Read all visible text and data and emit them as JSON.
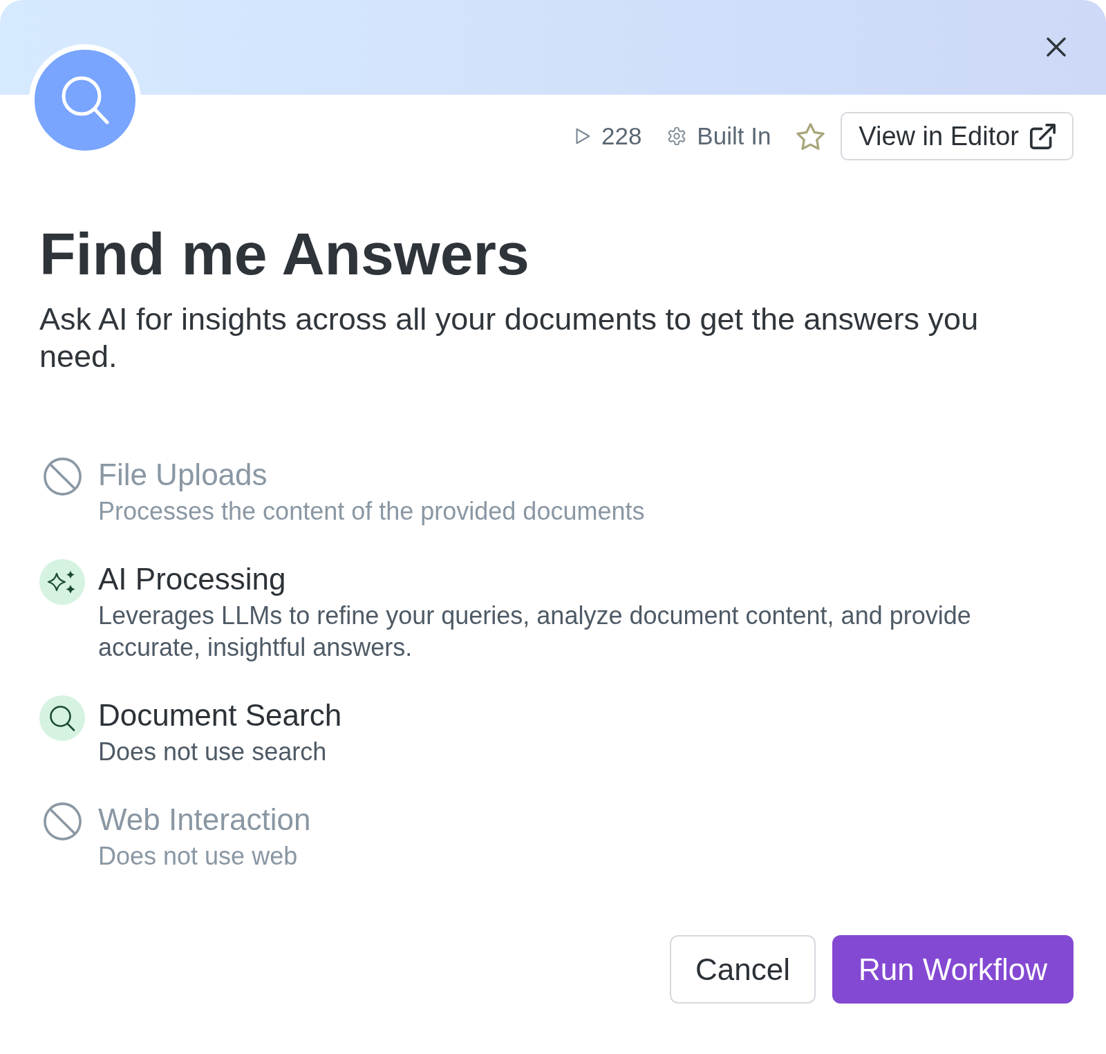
{
  "meta": {
    "run_count": "228",
    "source": "Built In",
    "starred": false,
    "editor_button": "View in Editor"
  },
  "title": "Find me Answers",
  "description": "Ask AI for insights across all your documents to get the answers you need.",
  "capabilities": [
    {
      "title": "File Uploads",
      "description": "Processes the content of the provided documents",
      "enabled": false
    },
    {
      "title": "AI Processing",
      "description": "Leverages LLMs to refine your queries, analyze document content, and provide accurate, insightful answers.",
      "enabled": true,
      "kind": "ai"
    },
    {
      "title": "Document Search",
      "description": "Does not use search",
      "enabled": true,
      "kind": "search"
    },
    {
      "title": "Web Interaction",
      "description": "Does not use web",
      "enabled": false
    }
  ],
  "buttons": [
    {
      "label": "Cancel",
      "kind": "secondary"
    },
    {
      "label": "Run Workflow",
      "kind": "primary"
    }
  ]
}
